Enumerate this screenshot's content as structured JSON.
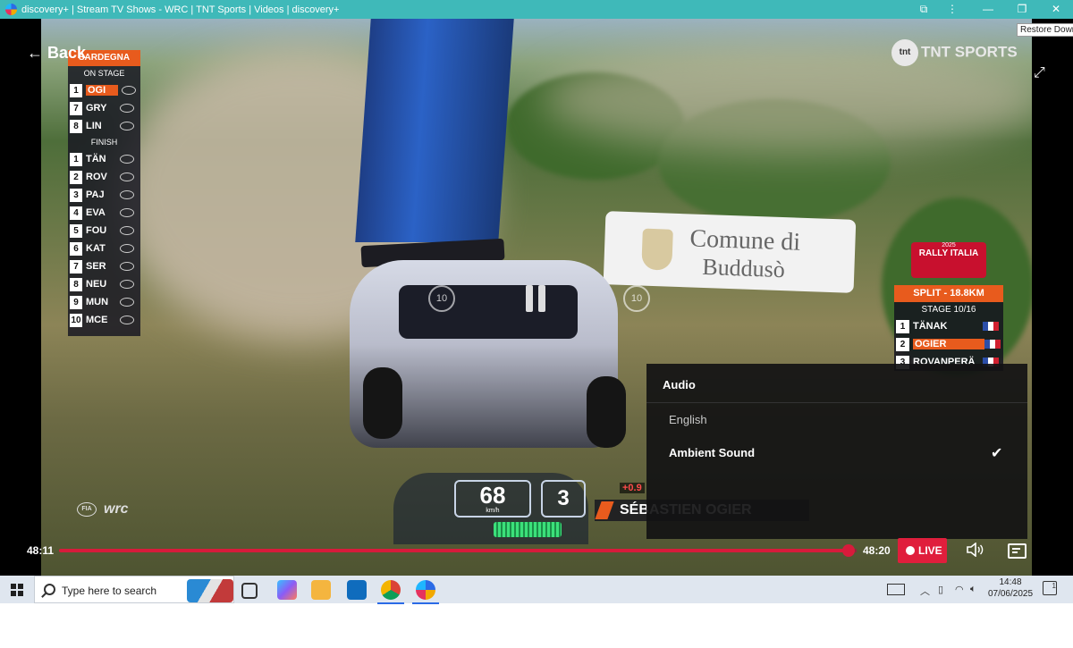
{
  "window": {
    "title": "discovery+ | Stream TV Shows - WRC | TNT Sports | Videos | discovery+",
    "tooltip": "Restore Down"
  },
  "player": {
    "back_label": "Back",
    "broadcaster": "TNT SPORTS",
    "broadcaster_mark": "tnt",
    "replay_back_label": "10",
    "replay_fwd_label": "10",
    "sign_line1": "Comune di",
    "sign_line2": "Buddusò",
    "wrc_logo": "wrc",
    "fia_label": "FIA"
  },
  "leaderboard": {
    "event": "SARDEGNA",
    "on_stage_label": "ON STAGE",
    "on_stage": [
      {
        "pos": "1",
        "name": "OGI",
        "highlight": true
      },
      {
        "pos": "7",
        "name": "GRY",
        "highlight": false
      },
      {
        "pos": "8",
        "name": "LIN",
        "highlight": false
      }
    ],
    "finish_label": "FINISH",
    "finish": [
      {
        "pos": "1",
        "name": "TÄN"
      },
      {
        "pos": "2",
        "name": "ROV"
      },
      {
        "pos": "3",
        "name": "PAJ"
      },
      {
        "pos": "4",
        "name": "EVA"
      },
      {
        "pos": "5",
        "name": "FOU"
      },
      {
        "pos": "6",
        "name": "KAT"
      },
      {
        "pos": "7",
        "name": "SER"
      },
      {
        "pos": "8",
        "name": "NEU"
      },
      {
        "pos": "9",
        "name": "MUN"
      },
      {
        "pos": "10",
        "name": "MCE"
      }
    ]
  },
  "rally": {
    "year": "2025",
    "name": "RALLY ITALIA",
    "split_label": "SPLIT - 18.8KM",
    "stage_label": "STAGE 10/16",
    "rows": [
      {
        "pos": "1",
        "name": "TÄNAK",
        "highlight": false
      },
      {
        "pos": "2",
        "name": "OGIER",
        "highlight": true
      },
      {
        "pos": "3",
        "name": "ROVANPERÄ",
        "highlight": false
      }
    ]
  },
  "telemetry": {
    "speed": "68",
    "speed_unit": "km/h",
    "gear": "3",
    "delta": "+0.9",
    "driver": "SÉBASTIEN OGIER"
  },
  "audio_menu": {
    "title": "Audio",
    "options": [
      {
        "label": "English",
        "selected": false
      },
      {
        "label": "Ambient Sound",
        "selected": true
      }
    ]
  },
  "controls": {
    "elapsed": "48:11",
    "duration": "48:20",
    "progress": 0.99,
    "live_label": "LIVE"
  },
  "taskbar": {
    "search_placeholder": "Type here to search",
    "time": "14:48",
    "date": "07/06/2025",
    "notification_count": "1"
  },
  "colors": {
    "titlebar": "#3fb9b9",
    "accent": "#d71b3b",
    "overlay_orange": "#e85b1d"
  }
}
